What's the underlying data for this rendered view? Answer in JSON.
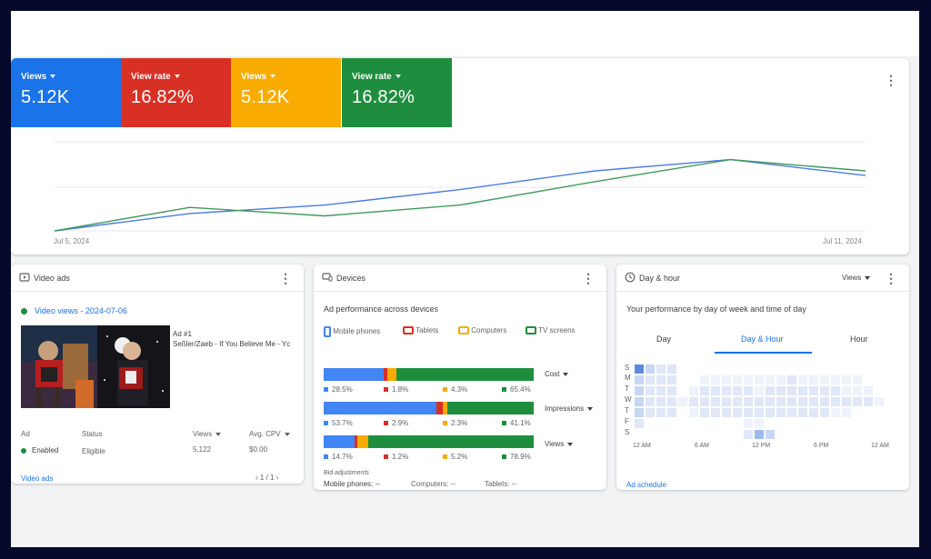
{
  "tiles": [
    {
      "label": "Views",
      "value": "5.12K",
      "color": "#1a73e8"
    },
    {
      "label": "View rate",
      "value": "16.82%",
      "color": "#d93025"
    },
    {
      "label": "Views",
      "value": "5.12K",
      "color": "#f9ab00"
    },
    {
      "label": "View rate",
      "value": "16.82%",
      "color": "#1e8e3e"
    }
  ],
  "overview": {
    "start_date": "Jul 5, 2024",
    "end_date": "Jul 11, 2024"
  },
  "chart_data": {
    "type": "line",
    "x": [
      "Jul 5, 2024",
      "Jul 6",
      "Jul 7",
      "Jul 8",
      "Jul 9",
      "Jul 10",
      "Jul 11, 2024"
    ],
    "series": [
      {
        "color": "#4a7be0",
        "values": [
          0.0,
          0.37,
          0.55,
          0.88,
          1.28,
          1.52,
          1.18
        ]
      },
      {
        "color": "#3f9a5a",
        "values": [
          0.0,
          0.5,
          0.32,
          0.55,
          1.05,
          1.52,
          1.28
        ]
      }
    ],
    "ylim": [
      0,
      1.9
    ],
    "grid": true
  },
  "video_ads": {
    "title": "Video ads",
    "campaign": "Video views - 2024-07-06",
    "ad_number": "Ad #1",
    "ad_title": "Seßler/Zaeb - If You Believe Me - Yc",
    "col_ad": "Ad",
    "col_status": "Status",
    "col_views": "Views",
    "col_cpv": "Avg. CPV",
    "row_ad": "Enabled",
    "row_status": "Eligible",
    "row_views": "5,122",
    "row_cpv": "$0.00",
    "footer_link": "Video ads",
    "pager": "1 / 1"
  },
  "devices": {
    "title": "Devices",
    "subtitle": "Ad performance across devices",
    "legend": [
      {
        "label": "Mobile phones",
        "color": "#4285f4"
      },
      {
        "label": "Tablets",
        "color": "#d93025"
      },
      {
        "label": "Computers",
        "color": "#f9ab00"
      },
      {
        "label": "TV screens",
        "color": "#1e8e3e"
      }
    ],
    "metrics": [
      {
        "name": "Cost",
        "values": [
          28.5,
          1.8,
          4.3,
          65.4
        ],
        "labels": [
          "28.5%",
          "1.8%",
          "4.3%",
          "65.4%"
        ]
      },
      {
        "name": "Impressions",
        "values": [
          53.7,
          2.9,
          2.3,
          41.1
        ],
        "labels": [
          "53.7%",
          "2.9%",
          "2.3%",
          "41.1%"
        ]
      },
      {
        "name": "Views",
        "values": [
          14.7,
          1.2,
          5.2,
          78.9
        ],
        "labels": [
          "14.7%",
          "1.2%",
          "5.2%",
          "78.9%"
        ]
      }
    ],
    "bid_title": "Bid adjustments",
    "bid_mobile": "Mobile phones: --",
    "bid_computers": "Computers: --",
    "bid_tablets": "Tablets: --"
  },
  "day_hour": {
    "title": "Day & hour",
    "dropdown": "Views",
    "subtitle": "Your performance by day of week and time of day",
    "tabs": [
      "Day",
      "Day & Hour",
      "Hour"
    ],
    "active_tab": 1,
    "days": [
      "S",
      "M",
      "T",
      "W",
      "T",
      "F",
      "S"
    ],
    "hour_labels": [
      "12 AM",
      "6 AM",
      "12 PM",
      "6 PM",
      "12 AM"
    ],
    "footer_link": "Ad schedule"
  }
}
